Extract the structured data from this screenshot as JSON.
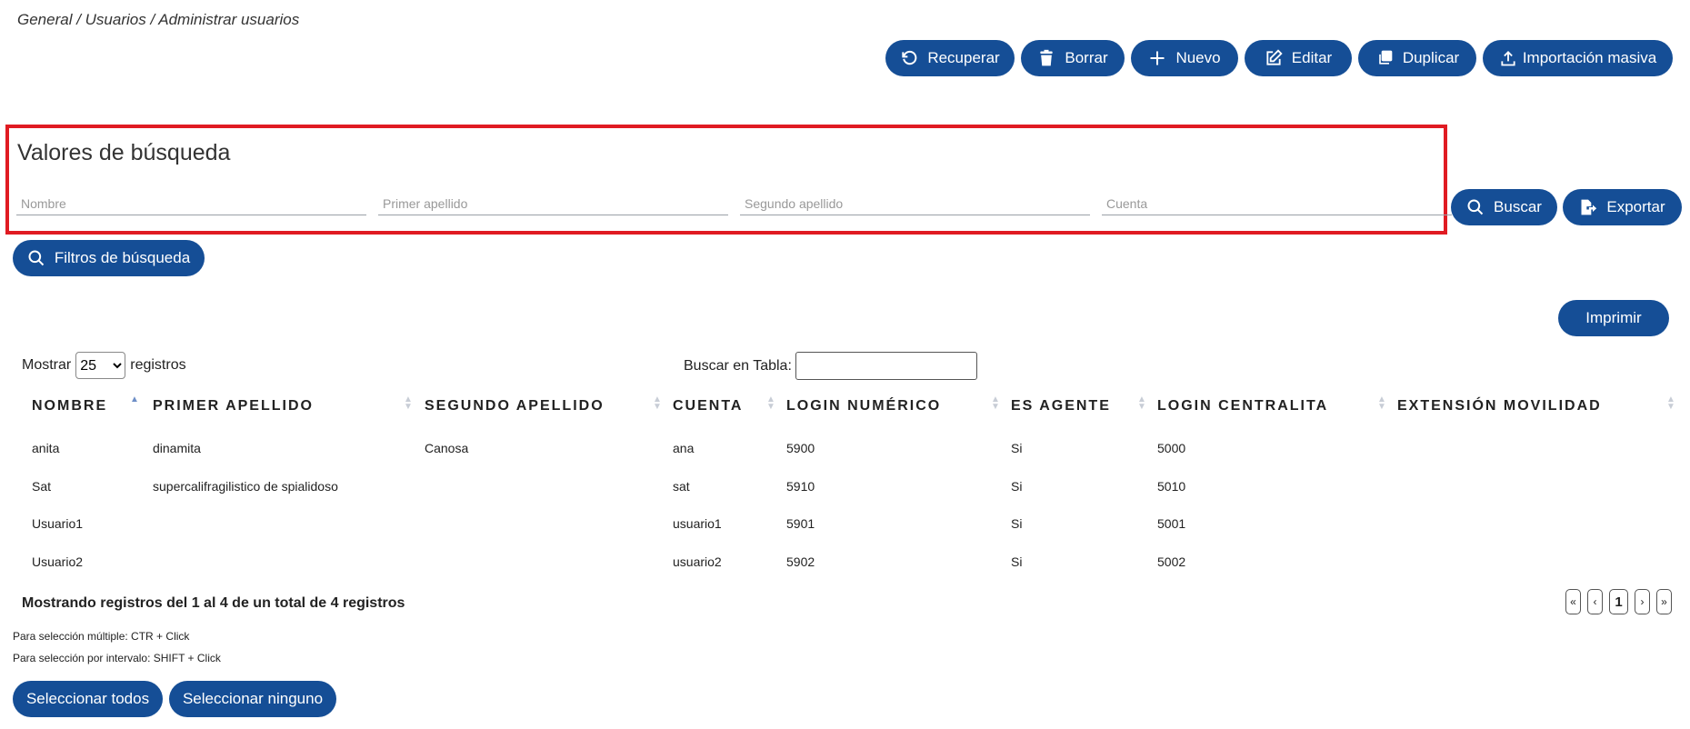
{
  "breadcrumb": "General / Usuarios / Administrar usuarios",
  "toolbar": {
    "recover": "Recuperar",
    "delete": "Borrar",
    "new": "Nuevo",
    "edit": "Editar",
    "duplicate": "Duplicar",
    "bulk_import": "Importación masiva"
  },
  "search": {
    "title": "Valores de búsqueda",
    "name_placeholder": "Nombre",
    "last1_placeholder": "Primer apellido",
    "last2_placeholder": "Segundo apellido",
    "account_placeholder": "Cuenta",
    "search_button": "Buscar",
    "export_button": "Exportar",
    "filters_button": "Filtros de búsqueda"
  },
  "print_button": "Imprimir",
  "length": {
    "before": "Mostrar",
    "selected": "25",
    "after": "registros"
  },
  "table_search_label": "Buscar en Tabla:",
  "table": {
    "headers": [
      "Nombre",
      "Primer apellido",
      "Segundo apellido",
      "Cuenta",
      "Login numérico",
      "Es agente",
      "Login centralita",
      "Extensión movilidad"
    ],
    "rows": [
      [
        "anita",
        "dinamita",
        "Canosa",
        "ana",
        "5900",
        "Si",
        "5000",
        ""
      ],
      [
        "Sat",
        "supercalifragilistico de spialidoso",
        "",
        "sat",
        "5910",
        "Si",
        "5010",
        ""
      ],
      [
        "Usuario1",
        "",
        "",
        "usuario1",
        "5901",
        "Si",
        "5001",
        ""
      ],
      [
        "Usuario2",
        "",
        "",
        "usuario2",
        "5902",
        "Si",
        "5002",
        ""
      ]
    ]
  },
  "info": "Mostrando registros del 1 al 4 de un total de 4 registros",
  "pagination": {
    "first": "«",
    "prev": "‹",
    "current": "1",
    "next": "›",
    "last": "»"
  },
  "hints": {
    "multi": "Para selección múltiple: CTR + Click",
    "range": "Para selección por intervalo: SHIFT + Click"
  },
  "select_all": "Seleccionar todos",
  "select_none": "Seleccionar ninguno"
}
